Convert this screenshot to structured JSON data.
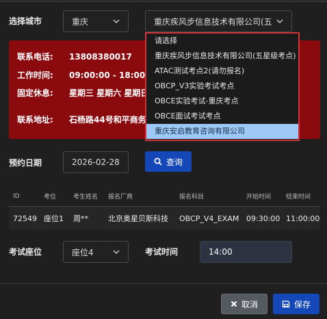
{
  "city": {
    "label": "选择城市",
    "selected": "重庆",
    "center_selected": "重庆疾风步信息技术有限公司(五星级"
  },
  "dropdown": {
    "options": [
      "请选择",
      "重庆疾风步信息技术有限公司(五星级考点)",
      "ATAC测试考点2(请勿报名)",
      "OBCP_V3实验考试考点",
      "OBCE实验考试-重庆考点",
      "OBCE面试考试考点",
      "重庆安启教育咨询有限公司"
    ],
    "highlighted_index": 6
  },
  "info": {
    "phone_label": "联系电话:",
    "phone": "13808380017",
    "hours_label": "工作时间:",
    "hours": "09:00:00 - 18:00:00",
    "rest_label": "固定休息:",
    "rest": "星期三 星期六 星期日",
    "address_label": "联系地址:",
    "address": "石杨路44号和平商务大"
  },
  "booking": {
    "date_label": "预约日期",
    "date_value": "2026-02-28",
    "query_label": "查询"
  },
  "table": {
    "headers": [
      "ID",
      "考位",
      "考生姓名",
      "报名厂商",
      "报名科目",
      "开始时间",
      "结束时间"
    ],
    "rows": [
      [
        "72549",
        "座位1",
        "周**",
        "北京奥星贝斯科技",
        "OBCP_V4_EXAM",
        "09:30:00",
        "11:00:00"
      ]
    ]
  },
  "seat": {
    "label": "考试座位",
    "selected": "座位4",
    "time_label": "考试时间",
    "time_value": "14:00"
  },
  "footer": {
    "cancel_label": "取消",
    "save_label": "保存"
  },
  "colors": {
    "info_bg": "#8b0a0d",
    "primary": "#1447b8",
    "highlight": "#9ec9f6",
    "dropdown_border": "#d0333a"
  }
}
